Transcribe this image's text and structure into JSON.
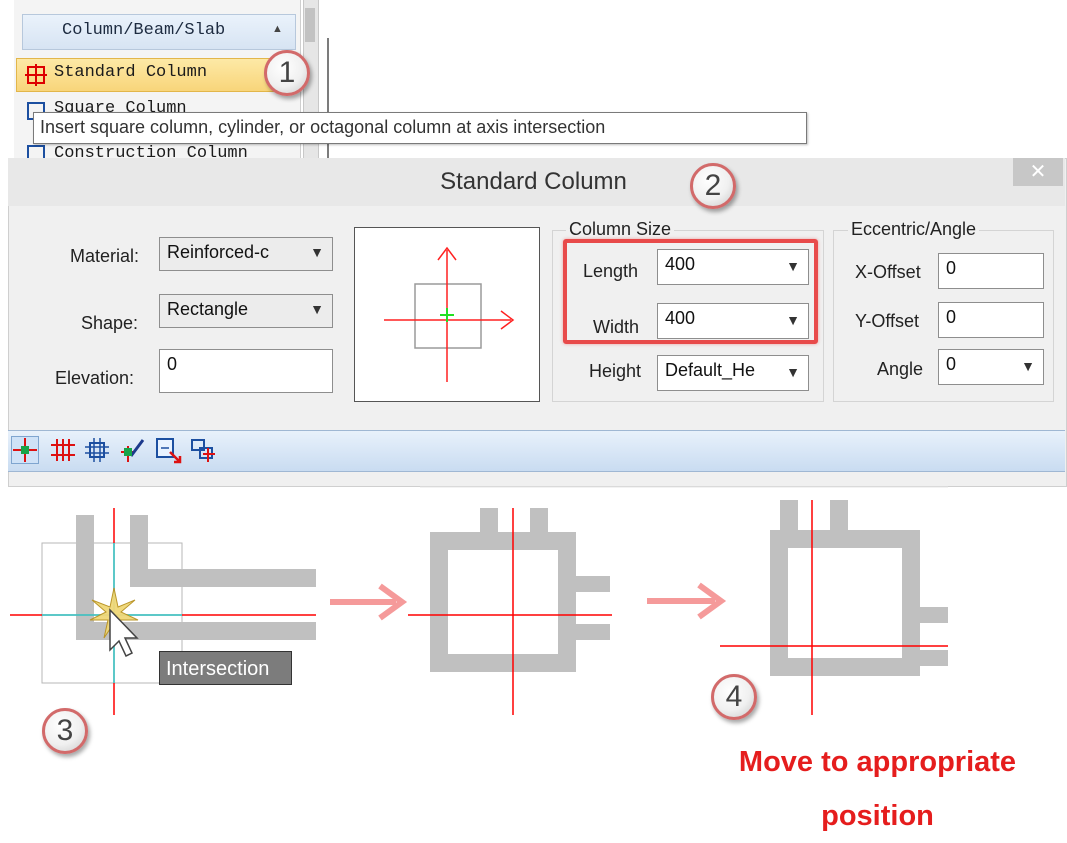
{
  "menu": {
    "header": "Column/Beam/Slab",
    "items": [
      {
        "label": "Standard Column",
        "selected": true
      },
      {
        "label": "Square Column",
        "selected": false
      },
      {
        "label": "Construction Column",
        "selected": false
      }
    ]
  },
  "tooltip": "Insert square column, cylinder, or octagonal column at axis intersection",
  "markers": [
    "1",
    "2",
    "3",
    "4"
  ],
  "dialog": {
    "title": "Standard Column",
    "close": "✕",
    "material_label": "Material:",
    "material_value": "Reinforced-c",
    "shape_label": "Shape:",
    "shape_value": "Rectangle",
    "elevation_label": "Elevation:",
    "elevation_value": "0",
    "column_size": {
      "legend": "Column Size",
      "length_label": "Length",
      "length_value": "400",
      "width_label": "Width",
      "width_value": "400",
      "height_label": "Height",
      "height_value": "Default_He"
    },
    "eccentric": {
      "legend": "Eccentric/Angle",
      "x_offset_label": "X-Offset",
      "x_offset_value": "0",
      "y_offset_label": "Y-Offset",
      "y_offset_value": "0",
      "angle_label": "Angle",
      "angle_value": "0"
    }
  },
  "toolbar_icons": [
    "point-insert-icon",
    "axis-insert-icon",
    "region-insert-icon",
    "replace-icon",
    "window-select-icon",
    "batch-icon"
  ],
  "steps": {
    "intersection_tip": "Intersection",
    "caption_line1": "Move to appropriate",
    "caption_line2": "position"
  },
  "colors": {
    "accent_red": "#e51d1d",
    "highlight_border": "#e84a4a",
    "axis_red": "#ff0000",
    "wall_gray": "#c0c0c0",
    "arrow_pink": "#f59a9a"
  }
}
